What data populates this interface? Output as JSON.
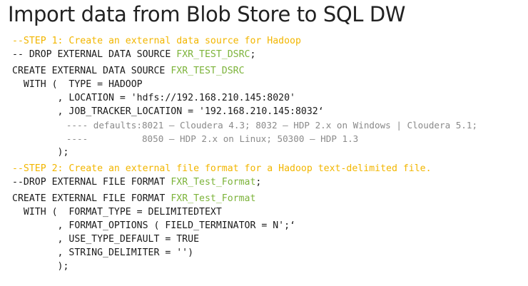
{
  "title": "Import data from Blob Store to SQL DW",
  "step1": {
    "comment": "--STEP 1: Create an external data source for Hadoop",
    "drop_prefix": "-- DROP EXTERNAL DATA SOURCE ",
    "drop_name": "FXR_TEST_DSRC",
    "drop_suffix": ";",
    "create_prefix": "CREATE EXTERNAL DATA SOURCE ",
    "create_name": "FXR_TEST_DSRC",
    "with_line": "  WITH (  TYPE = HADOOP",
    "location_line": "        , LOCATION = 'hdfs://192.168.210.145:8020'",
    "job_tracker_line": "        , JOB_TRACKER_LOCATION = '192.168.210.145:8032‘",
    "note_line1": "          ---- defaults:8021 – Cloudera 4.3; 8032 – HDP 2.x on Windows | Cloudera 5.1;",
    "note_line2": "          ----          8050 – HDP 2.x on Linux; 50300 – HDP 1.3",
    "close_line": "        );"
  },
  "step2": {
    "comment": "--STEP 2: Create an external file format for a Hadoop text-delimited file.",
    "drop_prefix": "--DROP EXTERNAL FILE FORMAT ",
    "drop_name": "FXR_Test_Format",
    "drop_suffix": ";",
    "create_prefix": "CREATE EXTERNAL FILE FORMAT ",
    "create_name": "FXR_Test_Format",
    "with_line": "  WITH (  FORMAT_TYPE = DELIMITEDTEXT",
    "format_options_line": "        , FORMAT_OPTIONS ( FIELD_TERMINATOR = N';‘",
    "use_type_default_line": "        , USE_TYPE_DEFAULT = TRUE",
    "string_delimiter_line": "        , STRING_DELIMITER = '')",
    "close_line": "        );"
  }
}
